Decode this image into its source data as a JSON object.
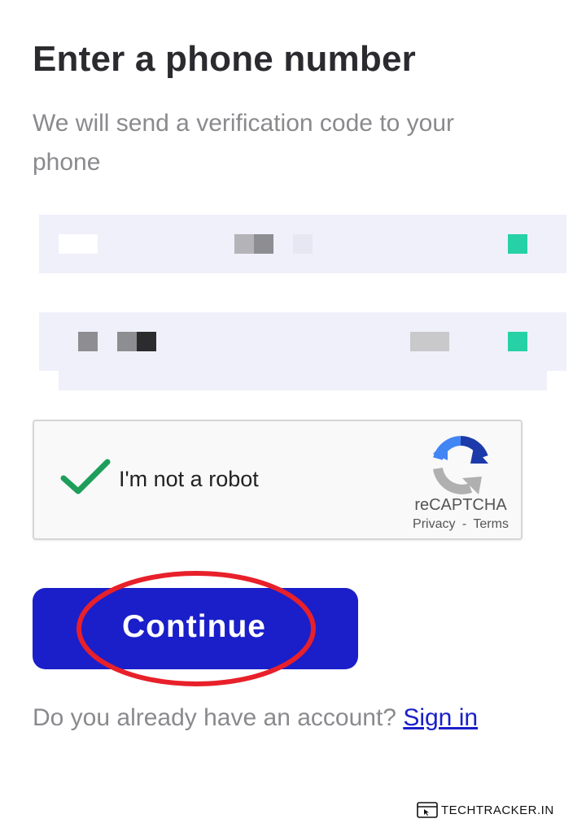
{
  "header": {
    "title": "Enter a phone number",
    "subtitle": "We will send a verification code to your phone"
  },
  "recaptcha": {
    "checkbox_label": "I'm not a robot",
    "checked": true,
    "brand": "reCAPTCHA",
    "privacy_label": "Privacy",
    "separator": "-",
    "terms_label": "Terms"
  },
  "actions": {
    "continue_label": "Continue"
  },
  "footer": {
    "prompt": "Do you already have an account?",
    "signin_label": "Sign in"
  },
  "watermark": {
    "text": "TECHTRACKER.IN"
  },
  "colors": {
    "primary": "#1a1fc9",
    "field_background": "#eff0fa",
    "accent_teal": "#26d1a6",
    "highlight_ring": "#e8202a",
    "check_green": "#1e9e5a"
  }
}
